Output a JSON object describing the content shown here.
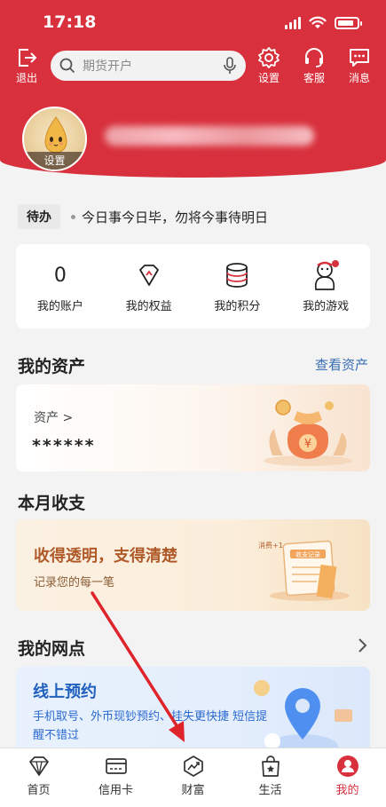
{
  "status_bar": {
    "time": "17:18",
    "battery_level": 0.85
  },
  "header": {
    "logout_label": "退出",
    "search_placeholder": "期货开户",
    "settings_label": "设置",
    "service_label": "客服",
    "messages_label": "消息",
    "avatar_tag": "设置"
  },
  "notice": {
    "tag": "待办",
    "text": "今日事今日毕，勿将今事待明日"
  },
  "quick": [
    {
      "value": "0",
      "label": "我的账户"
    },
    {
      "label": "我的权益",
      "icon": "diamond-icon"
    },
    {
      "label": "我的积分",
      "icon": "database-icon"
    },
    {
      "label": "我的游戏",
      "icon": "snowman-icon"
    }
  ],
  "assets": {
    "title": "我的资产",
    "link": "查看资产",
    "label": "资产 >",
    "value": "******",
    "card_coin_text": "¥"
  },
  "income": {
    "title": "本月收支",
    "card_title": "收得透明，支得清楚",
    "card_sub": "记录您的每一笔",
    "bubble": "消费+1",
    "calendar_label": "收支记录"
  },
  "branch": {
    "title": "我的网点",
    "card_title": "线上预约",
    "card_sub": "手机取号、外币现钞预约、挂失更快捷 短信提醒不错过"
  },
  "tabbar": [
    {
      "label": "首页",
      "icon": "diamond-icon"
    },
    {
      "label": "信用卡",
      "icon": "credit-card-icon"
    },
    {
      "label": "财富",
      "icon": "trend-icon"
    },
    {
      "label": "生活",
      "icon": "shopping-bag-icon"
    },
    {
      "label": "我的",
      "icon": "user-icon",
      "active": true
    }
  ],
  "colors": {
    "brand_red": "#d8303c",
    "link_blue": "#3a6fb3"
  }
}
